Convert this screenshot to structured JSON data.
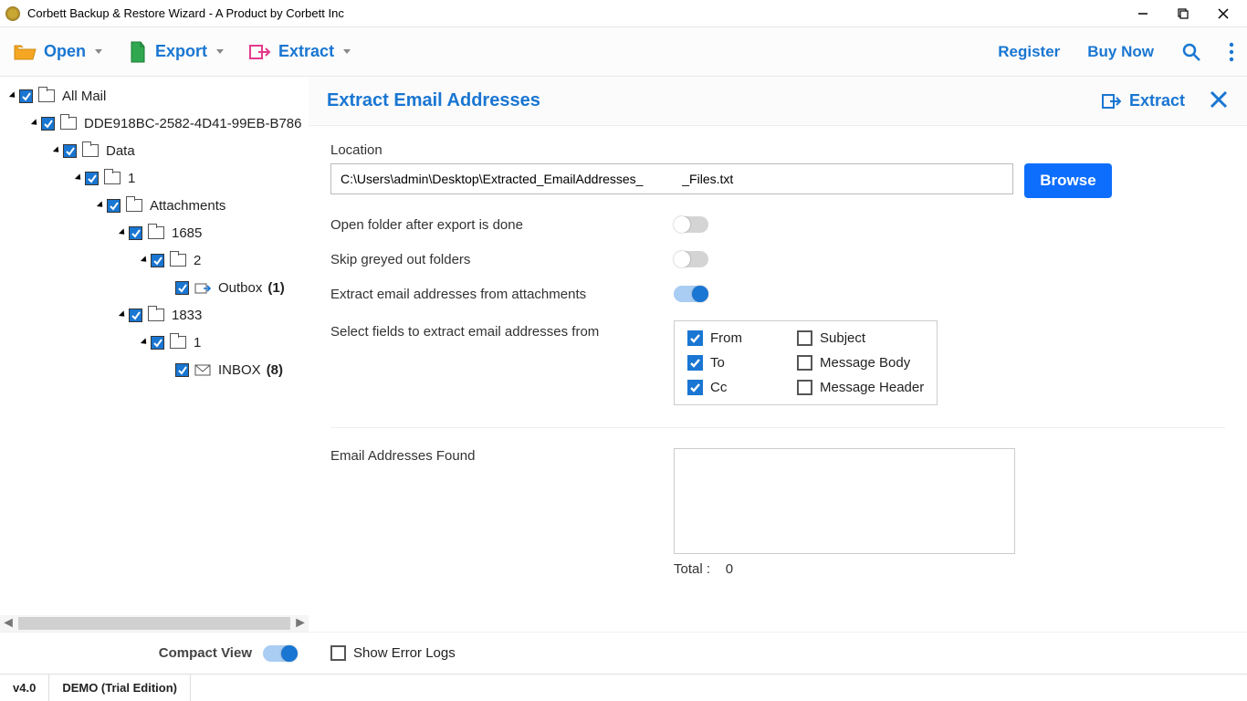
{
  "window_title": "Corbett Backup & Restore Wizard - A Product by Corbett Inc",
  "toolbar": {
    "open": "Open",
    "export": "Export",
    "extract": "Extract",
    "register": "Register",
    "buy": "Buy Now"
  },
  "tree": {
    "root": "All Mail",
    "guid": "DDE918BC-2582-4D41-99EB-B786",
    "data": "Data",
    "one_a": "1",
    "attachments": "Attachments",
    "n1685": "1685",
    "two": "2",
    "outbox": "Outbox",
    "outbox_count": "(1)",
    "n1833": "1833",
    "one_b": "1",
    "inbox": "INBOX",
    "inbox_count": "(8)"
  },
  "compact_label": "Compact View",
  "panel": {
    "title": "Extract Email Addresses",
    "extract": "Extract",
    "location_label": "Location",
    "location_value": "C:\\Users\\admin\\Desktop\\Extracted_EmailAddresses_           _Files.txt",
    "browse": "Browse",
    "opt_open_folder": "Open folder after export is done",
    "opt_skip_greyed": "Skip greyed out folders",
    "opt_from_attach": "Extract email addresses from attachments",
    "fields_label": "Select fields to extract email addresses from",
    "fields": {
      "from": "From",
      "to": "To",
      "cc": "Cc",
      "subject": "Subject",
      "body": "Message Body",
      "header": "Message Header"
    },
    "found_label": "Email Addresses Found",
    "total_label": "Total :",
    "total_value": "0",
    "show_errors": "Show Error Logs"
  },
  "status": {
    "version": "v4.0",
    "edition": "DEMO (Trial Edition)"
  }
}
